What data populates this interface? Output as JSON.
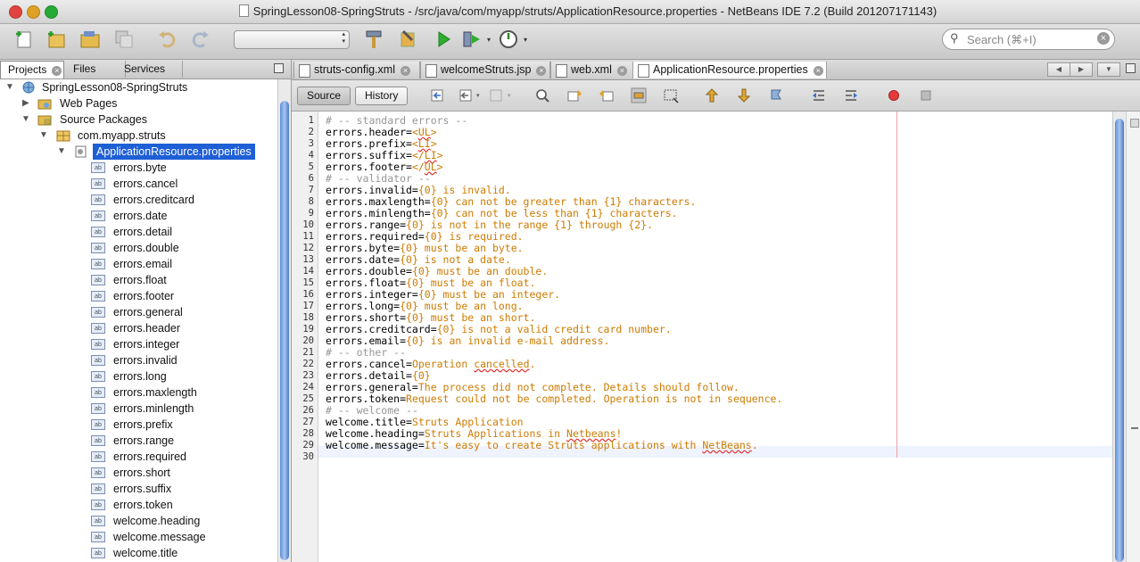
{
  "window": {
    "title": "SpringLesson08-SpringStruts - /src/java/com/myapp/struts/ApplicationResource.properties - NetBeans IDE 7.2 (Build 201207171143)"
  },
  "search": {
    "placeholder": "Search (⌘+I)"
  },
  "left_panel": {
    "tabs": [
      {
        "label": "Projects"
      },
      {
        "label": "Files"
      },
      {
        "label": "Services"
      }
    ],
    "tree": {
      "project": "SpringLesson08-SpringStruts",
      "web_pages": "Web Pages",
      "source_packages": "Source Packages",
      "package": "com.myapp.struts",
      "file": "ApplicationResource.properties",
      "keys": [
        "errors.byte",
        "errors.cancel",
        "errors.creditcard",
        "errors.date",
        "errors.detail",
        "errors.double",
        "errors.email",
        "errors.float",
        "errors.footer",
        "errors.general",
        "errors.header",
        "errors.integer",
        "errors.invalid",
        "errors.long",
        "errors.maxlength",
        "errors.minlength",
        "errors.prefix",
        "errors.range",
        "errors.required",
        "errors.short",
        "errors.suffix",
        "errors.token",
        "welcome.heading",
        "welcome.message",
        "welcome.title"
      ]
    }
  },
  "editor": {
    "tabs": [
      {
        "label": "struts-config.xml"
      },
      {
        "label": "welcomeStruts.jsp"
      },
      {
        "label": "web.xml"
      },
      {
        "label": "ApplicationResource.properties"
      }
    ],
    "source_label": "Source",
    "history_label": "History",
    "lines": [
      {
        "n": "1",
        "key": "",
        "val": "",
        "comment": "# -- standard errors --"
      },
      {
        "n": "2",
        "key": "errors.header=",
        "val": "<UL>",
        "comment": ""
      },
      {
        "n": "3",
        "key": "errors.prefix=",
        "val": "<LI>",
        "comment": ""
      },
      {
        "n": "4",
        "key": "errors.suffix=",
        "val": "</LI>",
        "comment": ""
      },
      {
        "n": "5",
        "key": "errors.footer=",
        "val": "</UL>",
        "comment": ""
      },
      {
        "n": "6",
        "key": "",
        "val": "",
        "comment": "# -- validator --"
      },
      {
        "n": "7",
        "key": "errors.invalid=",
        "val": "{0} is invalid.",
        "comment": ""
      },
      {
        "n": "8",
        "key": "errors.maxlength=",
        "val": "{0} can not be greater than {1} characters.",
        "comment": ""
      },
      {
        "n": "9",
        "key": "errors.minlength=",
        "val": "{0} can not be less than {1} characters.",
        "comment": ""
      },
      {
        "n": "10",
        "key": "errors.range=",
        "val": "{0} is not in the range {1} through {2}.",
        "comment": ""
      },
      {
        "n": "11",
        "key": "errors.required=",
        "val": "{0} is required.",
        "comment": ""
      },
      {
        "n": "12",
        "key": "errors.byte=",
        "val": "{0} must be an byte.",
        "comment": ""
      },
      {
        "n": "13",
        "key": "errors.date=",
        "val": "{0} is not a date.",
        "comment": ""
      },
      {
        "n": "14",
        "key": "errors.double=",
        "val": "{0} must be an double.",
        "comment": ""
      },
      {
        "n": "15",
        "key": "errors.float=",
        "val": "{0} must be an float.",
        "comment": ""
      },
      {
        "n": "16",
        "key": "errors.integer=",
        "val": "{0} must be an integer.",
        "comment": ""
      },
      {
        "n": "17",
        "key": "errors.long=",
        "val": "{0} must be an long.",
        "comment": ""
      },
      {
        "n": "18",
        "key": "errors.short=",
        "val": "{0} must be an short.",
        "comment": ""
      },
      {
        "n": "19",
        "key": "errors.creditcard=",
        "val": "{0} is not a valid credit card number.",
        "comment": ""
      },
      {
        "n": "20",
        "key": "errors.email=",
        "val": "{0} is an invalid e-mail address.",
        "comment": ""
      },
      {
        "n": "21",
        "key": "",
        "val": "",
        "comment": "# -- other --"
      },
      {
        "n": "22",
        "key": "errors.cancel=",
        "val": "Operation cancelled.",
        "comment": ""
      },
      {
        "n": "23",
        "key": "errors.detail=",
        "val": "{0}",
        "comment": ""
      },
      {
        "n": "24",
        "key": "errors.general=",
        "val": "The process did not complete. Details should follow.",
        "comment": ""
      },
      {
        "n": "25",
        "key": "errors.token=",
        "val": "Request could not be completed. Operation is not in sequence.",
        "comment": ""
      },
      {
        "n": "26",
        "key": "",
        "val": "",
        "comment": "# -- welcome --"
      },
      {
        "n": "27",
        "key": "welcome.title=",
        "val": "Struts Application",
        "comment": ""
      },
      {
        "n": "28",
        "key": "welcome.heading=",
        "val": "Struts Applications in Netbeans!",
        "comment": ""
      },
      {
        "n": "29",
        "key": "welcome.message=",
        "val": "It's easy to create Struts applications with NetBeans.",
        "comment": ""
      },
      {
        "n": "30",
        "key": "",
        "val": "",
        "comment": ""
      }
    ]
  }
}
